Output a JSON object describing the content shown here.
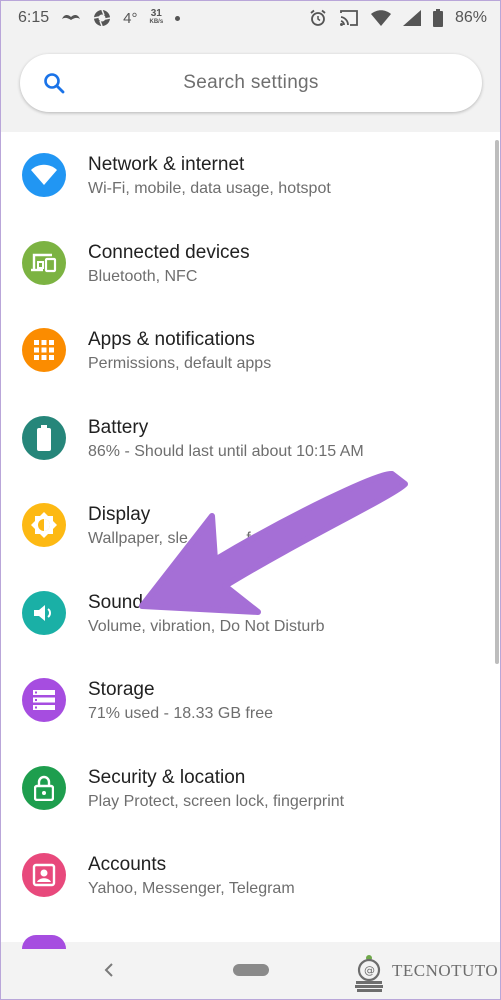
{
  "status_bar": {
    "time": "6:15",
    "temperature": "4°",
    "data_speed": "31",
    "data_speed_unit": "KB/s",
    "battery_percent": "86%"
  },
  "search": {
    "placeholder": "Search settings"
  },
  "settings": [
    {
      "title": "Network & internet",
      "subtitle": "Wi-Fi, mobile, data usage, hotspot",
      "icon": "wifi-icon",
      "color": "#2196f3"
    },
    {
      "title": "Connected devices",
      "subtitle": "Bluetooth, NFC",
      "icon": "devices-icon",
      "color": "#7cb342"
    },
    {
      "title": "Apps & notifications",
      "subtitle": "Permissions, default apps",
      "icon": "apps-icon",
      "color": "#fb8c00"
    },
    {
      "title": "Battery",
      "subtitle": "86% - Should last until about 10:15 AM",
      "icon": "battery-icon",
      "color": "#26867a"
    },
    {
      "title": "Display",
      "subtitle": "Wallpaper, sle",
      "subtitle_tail": "fo",
      "icon": "brightness-icon",
      "color": "#fdb913"
    },
    {
      "title": "Sound",
      "subtitle": "Volume, vibration, Do Not Disturb",
      "icon": "volume-icon",
      "color": "#1ab0a6"
    },
    {
      "title": "Storage",
      "subtitle": "71% used - 18.33 GB free",
      "icon": "storage-icon",
      "color": "#a64de0"
    },
    {
      "title": "Security & location",
      "subtitle": "Play Protect, screen lock, fingerprint",
      "icon": "lock-icon",
      "color": "#1e9e4e"
    },
    {
      "title": "Accounts",
      "subtitle": "Yahoo, Messenger, Telegram",
      "icon": "account-icon",
      "color": "#e8497c"
    }
  ],
  "annotation": {
    "arrow_color": "#a56fd6"
  },
  "watermark": {
    "text": "TECNOTUTO"
  }
}
